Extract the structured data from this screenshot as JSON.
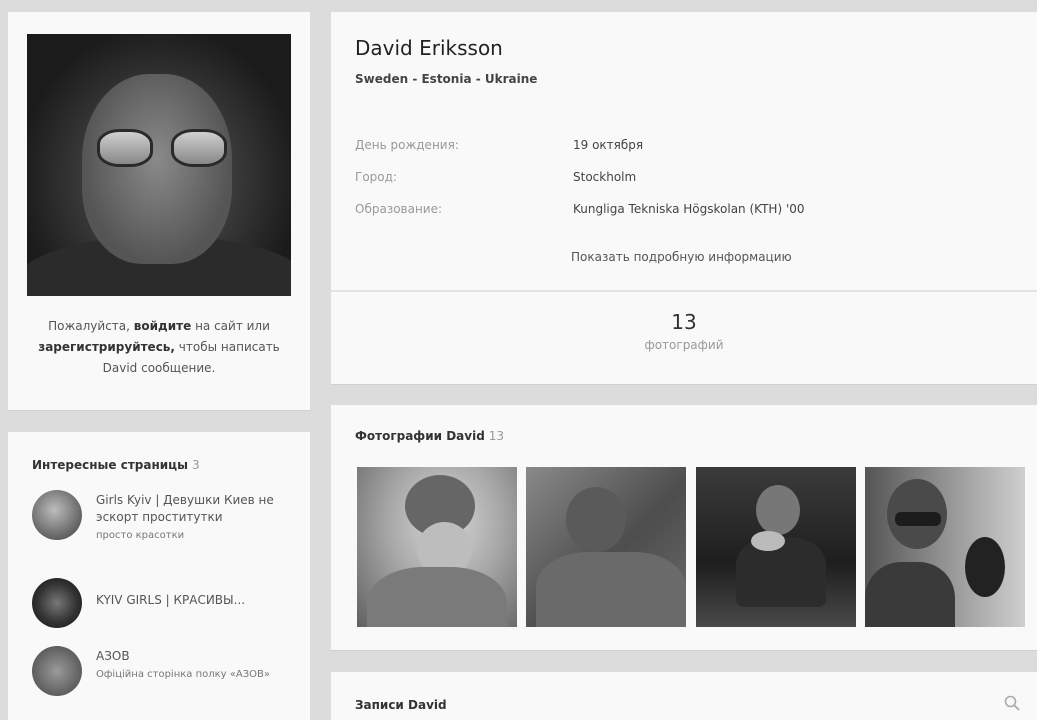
{
  "profile": {
    "name": "David Eriksson",
    "status": "Sweden - Estonia - Ukraine",
    "info": [
      {
        "label": "День рождения:",
        "value": "19 октября"
      },
      {
        "label": "Город:",
        "value": "Stockholm"
      },
      {
        "label": "Образование:",
        "value": "Kungliga Tekniska Högskolan (KTH) '00"
      }
    ],
    "more_link": "Показать подробную информацию",
    "photo_count": "13",
    "photo_count_label": "фотографий"
  },
  "login_note": {
    "p1": "Пожалуйста,",
    "login": "войдите",
    "p2": "на сайт или",
    "register": "зарегистрируйтесь,",
    "p3": "чтобы написать David сообщение."
  },
  "interesting_pages": {
    "title": "Интересные страницы",
    "count": "3",
    "items": [
      {
        "name": "Girls Kyiv | Девушки Киев не эскорт проститутки",
        "sub": "просто красотки"
      },
      {
        "name": "KYIV GIRLS | КРАСИВЫ...",
        "sub": ""
      },
      {
        "name": "АЗОВ",
        "sub": "Офіційна сторінка полку «АЗОВ»"
      }
    ]
  },
  "photos": {
    "title": "Фотографии David",
    "count": "13"
  },
  "wall": {
    "title": "Записи David"
  },
  "icons": {
    "search": "search-icon"
  }
}
